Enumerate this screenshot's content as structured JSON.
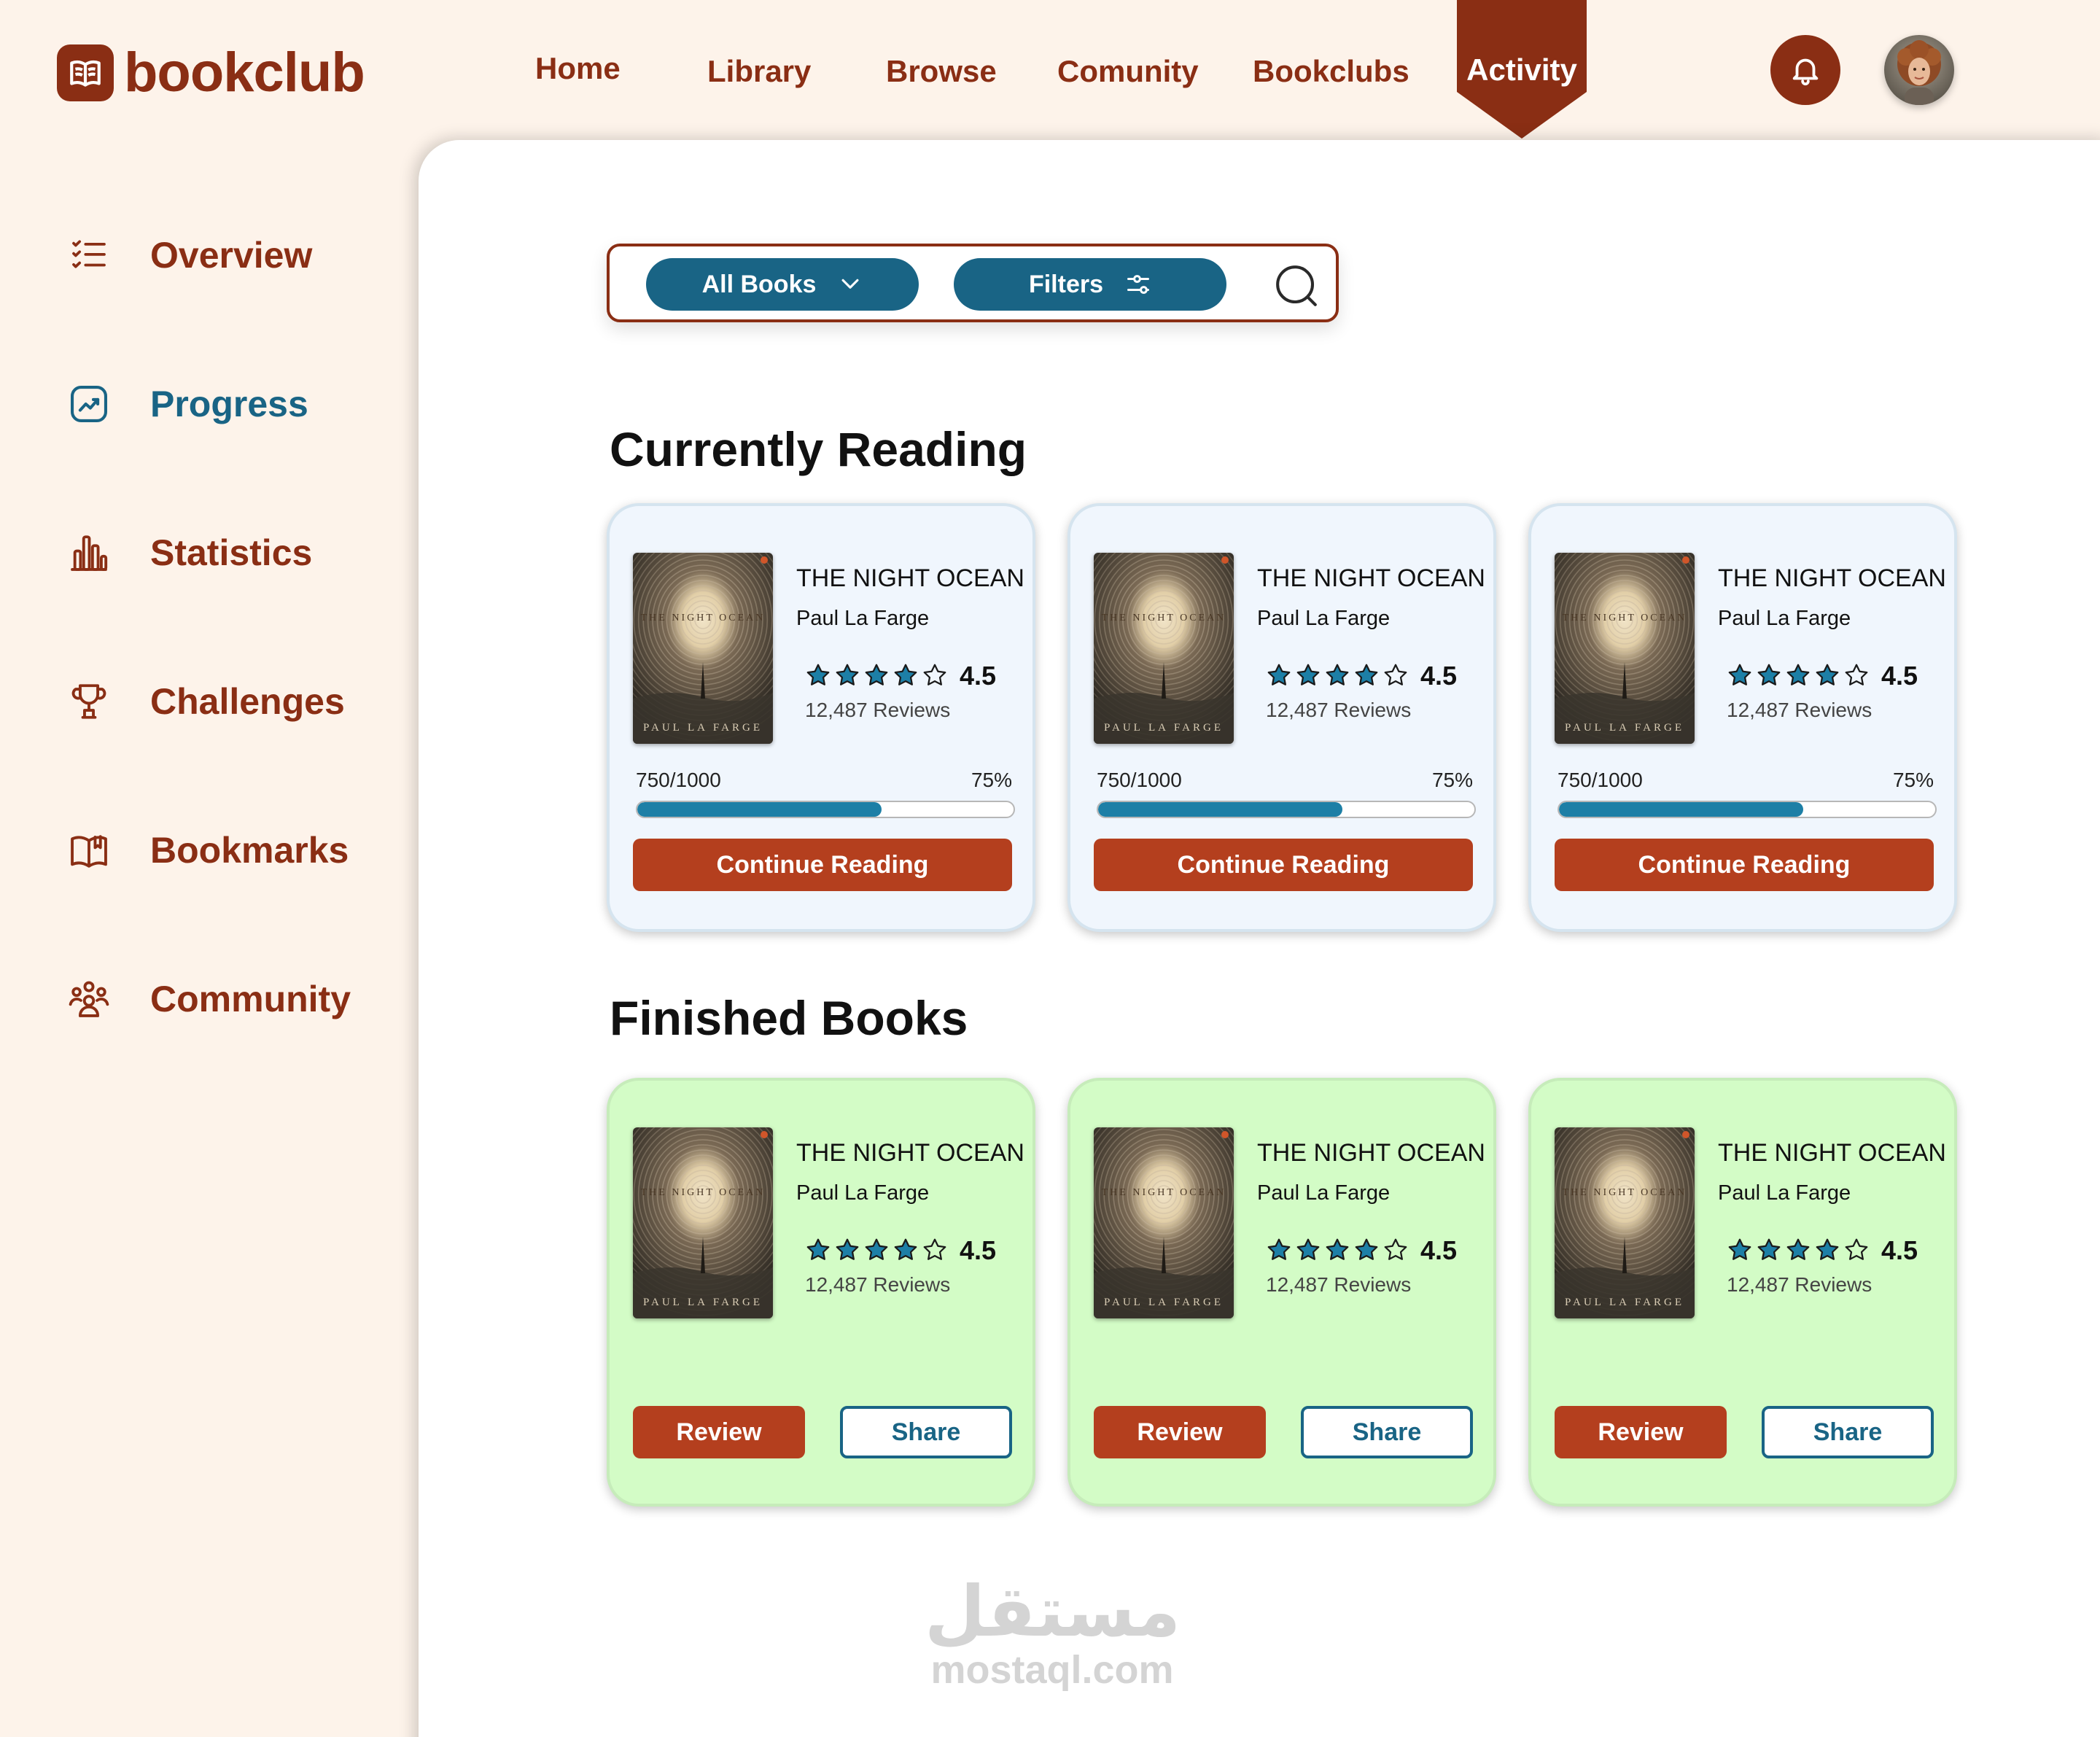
{
  "app": {
    "brand": "bookclub"
  },
  "nav": {
    "items": [
      "Home",
      "Library",
      "Browse",
      "Comunity",
      "Bookclubs"
    ],
    "active": "Activity"
  },
  "sidebar": {
    "items": [
      {
        "label": "Overview",
        "icon": "list-check-icon",
        "active": false
      },
      {
        "label": "Progress",
        "icon": "trend-chart-icon",
        "active": true
      },
      {
        "label": "Statistics",
        "icon": "bar-chart-icon",
        "active": false
      },
      {
        "label": "Challenges",
        "icon": "trophy-icon",
        "active": false
      },
      {
        "label": "Bookmarks",
        "icon": "open-book-icon",
        "active": false
      },
      {
        "label": "Community",
        "icon": "people-group-icon",
        "active": false
      }
    ]
  },
  "search": {
    "value": "",
    "placeholder": ""
  },
  "toolbar": {
    "all_books_label": "All Books",
    "filters_label": "Filters"
  },
  "currently_reading": {
    "title": "Currently Reading",
    "books": [
      {
        "title": "THE NIGHT OCEAN",
        "author": "Paul La Farge",
        "rating": "4.5",
        "stars": 4.5,
        "reviews": "12,487 Reviews",
        "pages": "750/1000",
        "progress_label": "75%",
        "progress": 0.65,
        "button": "Continue Reading",
        "cover_title": "THE NIGHT OCEAN",
        "cover_author": "PAUL LA FARGE"
      },
      {
        "title": "THE NIGHT OCEAN",
        "author": "Paul La Farge",
        "rating": "4.5",
        "stars": 4.5,
        "reviews": "12,487 Reviews",
        "pages": "750/1000",
        "progress_label": "75%",
        "progress": 0.65,
        "button": "Continue Reading",
        "cover_title": "THE NIGHT OCEAN",
        "cover_author": "PAUL LA FARGE"
      },
      {
        "title": "THE NIGHT OCEAN",
        "author": "Paul La Farge",
        "rating": "4.5",
        "stars": 4.5,
        "reviews": "12,487 Reviews",
        "pages": "750/1000",
        "progress_label": "75%",
        "progress": 0.65,
        "button": "Continue Reading",
        "cover_title": "THE NIGHT OCEAN",
        "cover_author": "PAUL LA FARGE"
      }
    ]
  },
  "finished_books": {
    "title": "Finished Books",
    "books": [
      {
        "title": "THE NIGHT OCEAN",
        "author": "Paul La Farge",
        "rating": "4.5",
        "stars": 4.5,
        "reviews": "12,487 Reviews",
        "review_button": "Review",
        "share_button": "Share",
        "cover_title": "THE NIGHT OCEAN",
        "cover_author": "PAUL LA FARGE"
      },
      {
        "title": "THE NIGHT OCEAN",
        "author": "Paul La Farge",
        "rating": "4.5",
        "stars": 4.5,
        "reviews": "12,487 Reviews",
        "review_button": "Review",
        "share_button": "Share",
        "cover_title": "THE NIGHT OCEAN",
        "cover_author": "PAUL LA FARGE"
      },
      {
        "title": "THE NIGHT OCEAN",
        "author": "Paul La Farge",
        "rating": "4.5",
        "stars": 4.5,
        "reviews": "12,487 Reviews",
        "review_button": "Review",
        "share_button": "Share",
        "cover_title": "THE NIGHT OCEAN",
        "cover_author": "PAUL LA FARGE"
      }
    ]
  },
  "watermark": {
    "arabic": "مستقل",
    "latin": "mostaql.com"
  },
  "colors": {
    "brand": "#8a2e14",
    "accent_blue": "#196485",
    "button_orange": "#b43f1e",
    "progress": "#1d7fa6",
    "star": "#1d7fa6",
    "reading_card": "#f0f6fd",
    "finished_card": "#d3fcc6",
    "background": "#fdf3ea"
  }
}
